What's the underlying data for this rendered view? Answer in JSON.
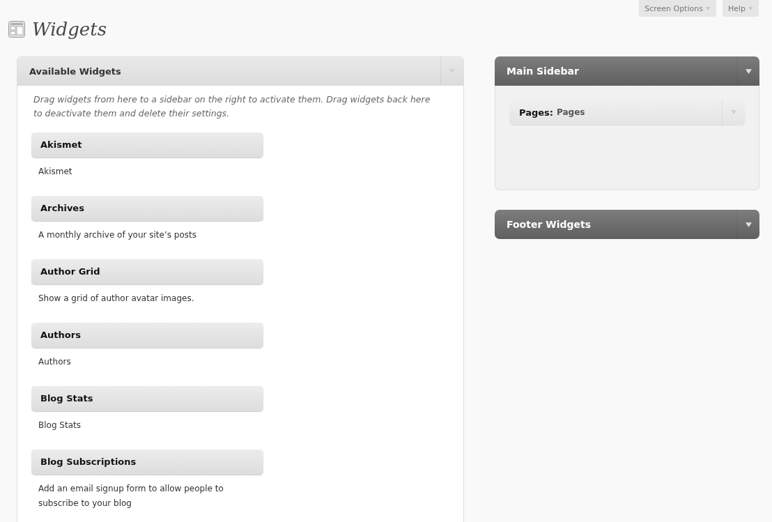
{
  "header_links": [
    {
      "label": "Screen Options"
    },
    {
      "label": "Help"
    }
  ],
  "page_title": "Widgets",
  "available": {
    "title": "Available Widgets",
    "description": "Drag widgets from here to a sidebar on the right to activate them. Drag widgets back here to deactivate them and delete their settings.",
    "widgets": [
      {
        "name": "Akismet",
        "description": "Akismet"
      },
      {
        "name": "Archives",
        "description": "A monthly archive of your site’s posts"
      },
      {
        "name": "Author Grid",
        "description": "Show a grid of author avatar images."
      },
      {
        "name": "Authors",
        "description": "Authors"
      },
      {
        "name": "Blog Stats",
        "description": "Blog Stats"
      },
      {
        "name": "Blog Subscriptions",
        "description": "Add an email signup form to allow people to subscribe to your blog"
      }
    ]
  },
  "sidebars": [
    {
      "title": "Main Sidebar",
      "expanded": true,
      "widgets": [
        {
          "name": "Pages:",
          "title": "Pages"
        }
      ]
    },
    {
      "title": "Footer Widgets",
      "expanded": false
    }
  ]
}
